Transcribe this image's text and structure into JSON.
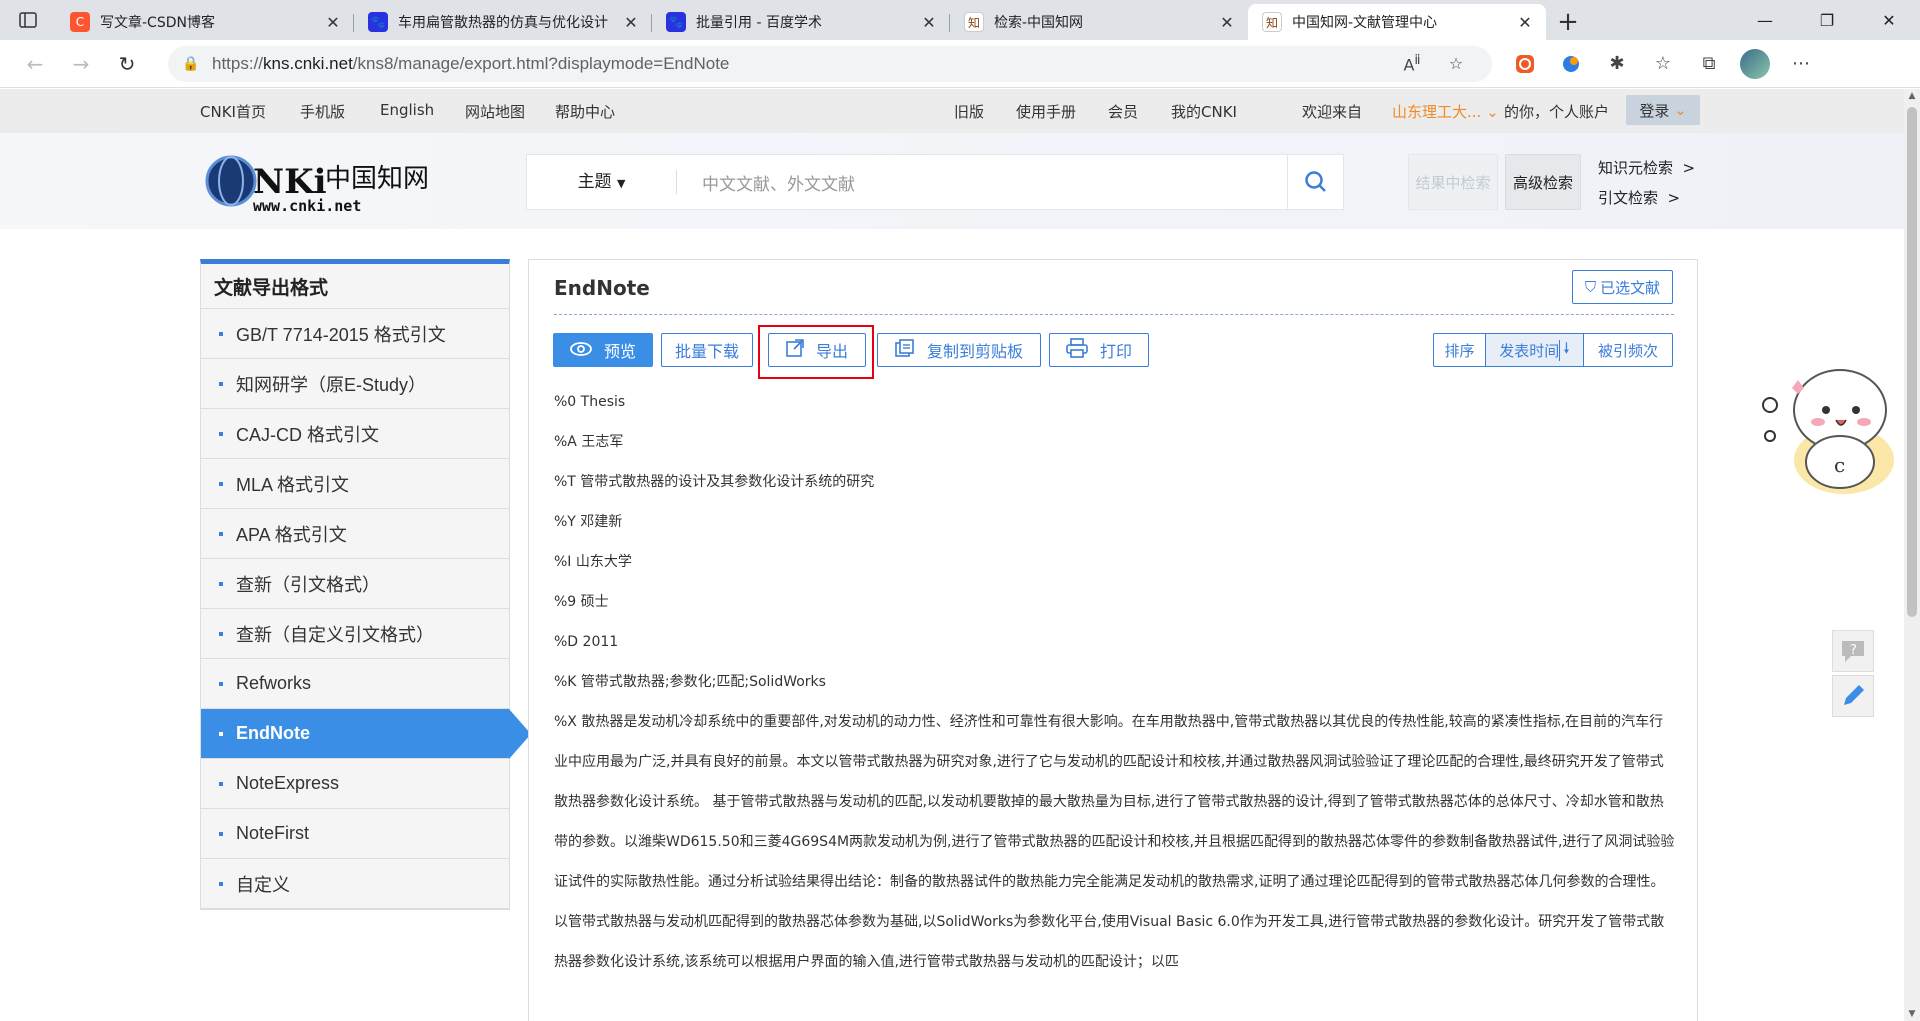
{
  "browser": {
    "tabs": [
      {
        "title": "写文章-CSDN博客",
        "favicon_color": "#fc5531",
        "favicon_glyph": "C"
      },
      {
        "title": "车用扁管散热器的仿真与优化设计",
        "favicon_color": "#2932e1",
        "favicon_glyph": "百"
      },
      {
        "title": "批量引用 - 百度学术",
        "favicon_color": "#2932e1",
        "favicon_glyph": "百"
      },
      {
        "title": "检索-中国知网",
        "favicon_color": "#a0522d",
        "favicon_glyph": "知"
      },
      {
        "title": "中国知网-文献管理中心",
        "favicon_color": "#a0522d",
        "favicon_glyph": "知"
      }
    ],
    "url_prefix": "https://",
    "url_host": "kns.cnki.net",
    "url_rest": "/kns8/manage/export.html?displaymode=EndNote"
  },
  "topbar": {
    "left_links": [
      "CNKI首页",
      "手机版",
      "English",
      "网站地图",
      "帮助中心"
    ],
    "right_links": [
      "旧版",
      "使用手册",
      "会员",
      "我的CNKI"
    ],
    "welcome": "欢迎来自",
    "institution": "山东理工大...",
    "personal": "的你，个人账户",
    "login": "登录"
  },
  "header": {
    "logo_text": "CNKi中国知网",
    "logo_url_text": "www.cnki.net",
    "search_field": "主题",
    "search_placeholder": "中文文献、外文文献",
    "result_search": "结果中检索",
    "advanced_search": "高级检索",
    "knowledge_search": "知识元检索",
    "citation_search": "引文检索"
  },
  "sidebar": {
    "heading": "文献导出格式",
    "items": [
      "GB/T 7714-2015 格式引文",
      "知网研学（原E-Study）",
      "CAJ-CD 格式引文",
      "MLA 格式引文",
      "APA 格式引文",
      "查新（引文格式）",
      "查新（自定义引文格式）",
      "Refworks",
      "EndNote",
      "NoteExpress",
      "NoteFirst",
      "自定义"
    ],
    "active_index": 8
  },
  "panel": {
    "title": "EndNote",
    "selected_docs": "已选文献",
    "preview": "预览",
    "batch_download": "批量下载",
    "export": "导出",
    "copy_clipboard": "复制到剪贴板",
    "print": "打印",
    "sort_label": "排序",
    "sort_pubtime": "发表时间",
    "sort_cited": "被引频次",
    "refs": [
      "%0 Thesis",
      "%A 王志军",
      "%T 管带式散热器的设计及其参数化设计系统的研究",
      "%Y 邓建新",
      "%I 山东大学",
      "%9 硕士",
      "%D 2011",
      "%K 管带式散热器;参数化;匹配;SolidWorks",
      "%X 散热器是发动机冷却系统中的重要部件,对发动机的动力性、经济性和可靠性有很大影响。在车用散热器中,管带式散热器以其优良的传热性能,较高的紧凑性指标,在目前的汽车行业中应用最为广泛,并具有良好的前景。本文以管带式散热器为研究对象,进行了它与发动机的匹配设计和校核,并通过散热器风洞试验验证了理论匹配的合理性,最终研究开发了管带式散热器参数化设计系统。 基于管带式散热器与发动机的匹配,以发动机要散掉的最大散热量为目标,进行了管带式散热器的设计,得到了管带式散热器芯体的总体尺寸、冷却水管和散热带的参数。以潍柴WD615.50和三菱4G69S4M两款发动机为例,进行了管带式散热器的匹配设计和校核,并且根据匹配得到的散热器芯体零件的参数制备散热器试件,进行了风洞试验验证试件的实际散热性能。通过分析试验结果得出结论：制备的散热器试件的散热能力完全能满足发动机的散热需求,证明了通过理论匹配得到的管带式散热器芯体几何参数的合理性。 以管带式散热器与发动机匹配得到的散热器芯体参数为基础,以SolidWorks为参数化平台,使用Visual Basic 6.0作为开发工具,进行管带式散热器的参数化设计。研究开发了管带式散热器参数化设计系统,该系统可以根据用户界面的输入值,进行管带式散热器与发动机的匹配设计；以匹"
    ]
  },
  "colors": {
    "accent": "#3a8ee6",
    "highlight_box": "#e60012",
    "institution": "#f08a24"
  }
}
